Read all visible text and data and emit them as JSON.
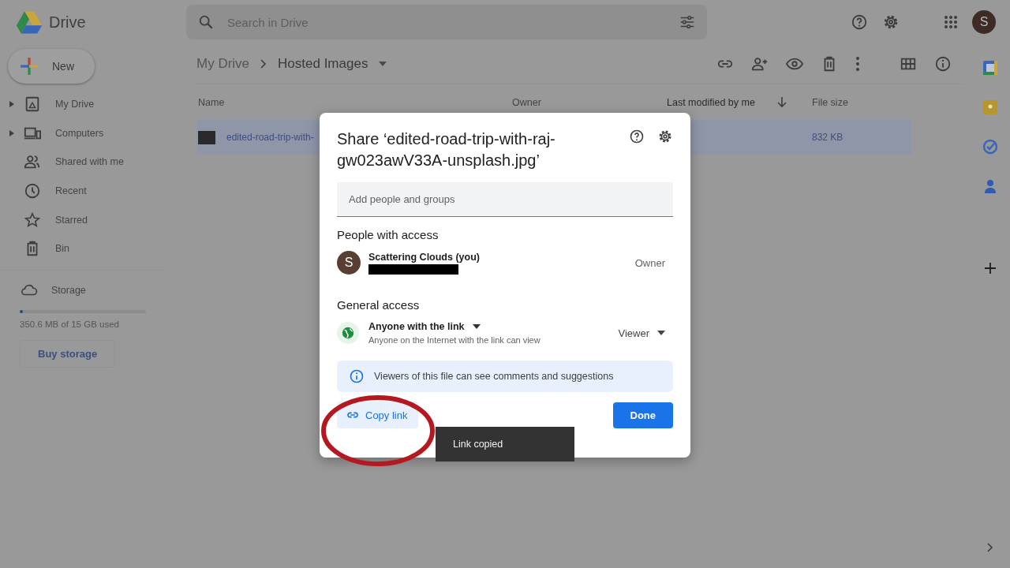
{
  "app": {
    "name": "Drive"
  },
  "search": {
    "placeholder": "Search in Drive"
  },
  "account": {
    "initial": "S"
  },
  "new_button": {
    "label": "New"
  },
  "sidebar": {
    "items": [
      {
        "label": "My Drive",
        "expandable": true,
        "selected": false
      },
      {
        "label": "Computers",
        "expandable": true,
        "selected": false
      },
      {
        "label": "Shared with me",
        "expandable": false,
        "selected": false
      },
      {
        "label": "Recent",
        "expandable": false,
        "selected": false
      },
      {
        "label": "Starred",
        "expandable": false,
        "selected": false
      },
      {
        "label": "Bin",
        "expandable": false,
        "selected": false
      }
    ]
  },
  "storage": {
    "label": "Storage",
    "level": 0.023,
    "usage": "350.6 MB of 15 GB used",
    "buy_label": "Buy storage"
  },
  "breadcrumb": [
    {
      "label": "My Drive"
    },
    {
      "label": "Hosted Images"
    }
  ],
  "table": {
    "columns": [
      {
        "label": "Name",
        "sorted": false
      },
      {
        "label": "Owner",
        "sorted": false
      },
      {
        "label": "Last modified by me",
        "sorted": true
      },
      {
        "label": "File size",
        "sorted": false
      }
    ],
    "rows": [
      {
        "name": "edited-road-trip-with-",
        "size": "832 KB",
        "selected": true
      }
    ]
  },
  "dialog": {
    "title": "Share ‘edited-road-trip-with-raj-gw023awV33A-unsplash.jpg’",
    "add_placeholder": "Add people and groups",
    "people_title": "People with access",
    "people": [
      {
        "initial": "S",
        "name": "Scattering Clouds (you)",
        "role": "Owner"
      }
    ],
    "general_title": "General access",
    "access": {
      "label": "Anyone with the link",
      "description": "Anyone on the Internet with the link can view",
      "role": "Viewer"
    },
    "info": "Viewers of this file can see comments and suggestions",
    "copy_label": "Copy link",
    "done_label": "Done"
  },
  "toast": {
    "message": "Link copied"
  }
}
